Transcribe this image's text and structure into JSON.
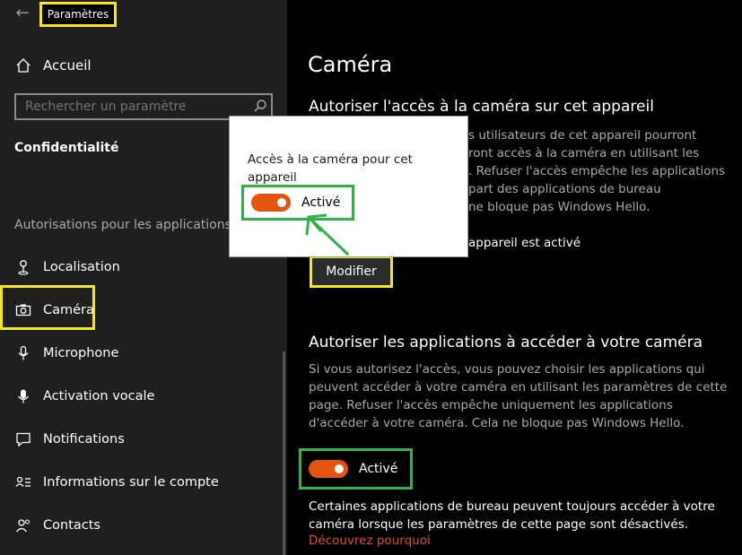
{
  "app": {
    "back_glyph": "←",
    "title": "Paramètres"
  },
  "sidebar": {
    "home_label": "Accueil",
    "search": {
      "placeholder": "Rechercher un paramètre"
    },
    "section_title": "Confidentialité",
    "group_header": "Autorisations pour les applications",
    "items": [
      {
        "label": "Localisation",
        "icon": "location-icon"
      },
      {
        "label": "Caméra",
        "icon": "camera-icon",
        "selected": true
      },
      {
        "label": "Microphone",
        "icon": "microphone-icon"
      },
      {
        "label": "Activation vocale",
        "icon": "voice-activation-icon"
      },
      {
        "label": "Notifications",
        "icon": "notifications-icon"
      },
      {
        "label": "Informations sur le compte",
        "icon": "account-info-icon"
      },
      {
        "label": "Contacts",
        "icon": "contacts-icon"
      }
    ]
  },
  "main": {
    "title": "Caméra",
    "device_section": {
      "heading": "Autoriser l'accès à la caméra sur cet appareil",
      "description_lines": [
        "s utilisateurs de cet appareil pourront",
        "ront accès à la caméra en utilisant les",
        ". Refuser l'accès empêche les applications",
        "part des applications de bureau",
        "ne bloque pas Windows Hello."
      ],
      "status": "appareil est activé",
      "modify_button": "Modifier"
    },
    "apps_section": {
      "heading": "Autoriser les applications à accéder à votre caméra",
      "description_lines": [
        "Si vous autorisez l'accès, vous pouvez choisir les applications qui",
        "peuvent accéder à votre caméra en utilisant les paramètres de cette",
        "page. Refuser l'accès empêche uniquement les applications",
        "d'accéder à votre caméra. Cela ne bloque pas Windows Hello."
      ],
      "toggle_label": "Activé",
      "note_lines": [
        "Certaines applications de bureau peuvent toujours accéder à votre",
        "caméra lorsque les paramètres de cette page sont désactivés."
      ],
      "link": "Découvrez pourquoi"
    },
    "popup": {
      "text_lines": [
        "Accès à la caméra pour cet",
        "appareil"
      ],
      "toggle_label": "Activé"
    }
  },
  "colors": {
    "highlight_yellow": "#f2ea1c",
    "highlight_green": "#2db34a",
    "toggle_on": "#e3540f",
    "link": "#e8482a"
  }
}
